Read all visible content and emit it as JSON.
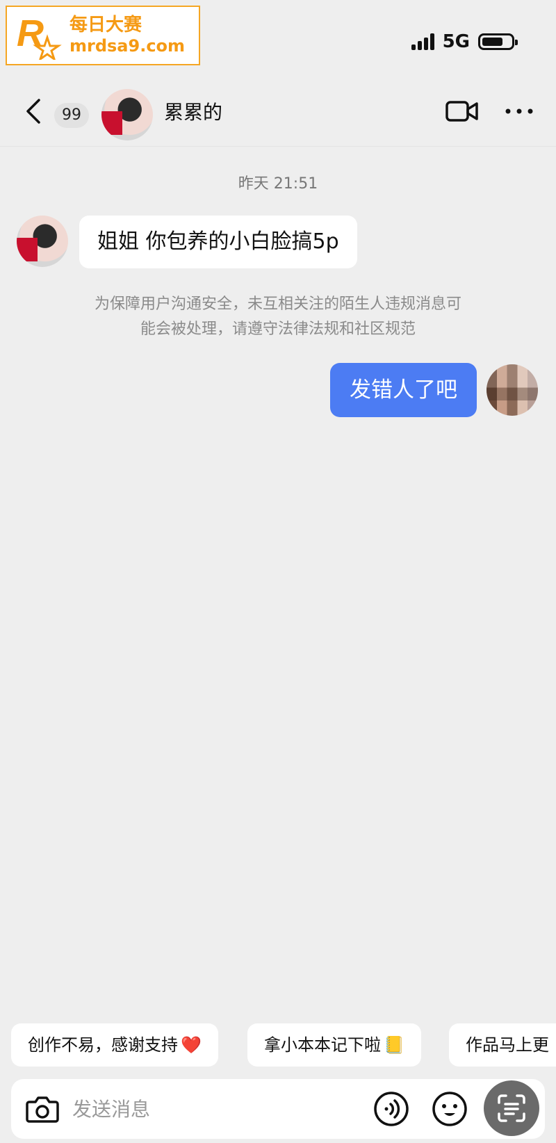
{
  "watermark": {
    "cn": "每日大赛",
    "url": "mrdsa9.com",
    "logo_letter": "R",
    "logo_small": "每日大赛"
  },
  "status_bar": {
    "network": "5G"
  },
  "header": {
    "unread_count": "99",
    "contact_name": "累累的"
  },
  "chat": {
    "timestamp": "昨天 21:51",
    "incoming_message": "姐姐 你包养的小白脸搞5p",
    "notice_line1": "为保障用户沟通安全，未互相关注的陌生人违规消息可",
    "notice_line2": "能会被处理，请遵守法律法规和社区规范",
    "outgoing_message": "发错人了吧"
  },
  "quick_replies": [
    {
      "text": "创作不易，感谢支持",
      "emoji": "❤️"
    },
    {
      "text": "拿小本本记下啦",
      "emoji": "📒"
    },
    {
      "text": "作品马上更"
    }
  ],
  "input": {
    "placeholder": "发送消息"
  },
  "colors": {
    "outgoing_bubble": "#4c7cf3",
    "watermark": "#f59a14",
    "background": "#eeeeee"
  }
}
